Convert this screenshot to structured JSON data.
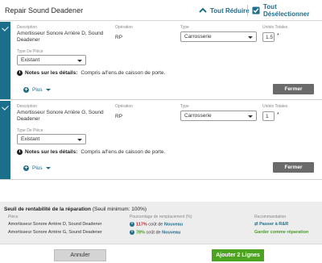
{
  "header": {
    "title": "Repair Sound Deadener",
    "collapse_all": "Tout Réduire",
    "deselect_all": "Tout Désélectionner"
  },
  "labels": {
    "description": "Description",
    "operation": "Opération",
    "type": "Type",
    "units_total": "Unités Totales",
    "part_type": "Type De Pièce",
    "notes": "Notes sur les détails:",
    "more": "Plus",
    "close": "Fermer"
  },
  "items": [
    {
      "description": "Amortisseur Sonore Arrière D, Sound Deadener",
      "operation": "RP",
      "type": "Carrosserie",
      "units": "1.5",
      "part_type": "Existant",
      "note": "Compris a/l'ens.de caisson de porte."
    },
    {
      "description": "Amortisseur Sonore Arrière G, Sound Deadener",
      "operation": "RP",
      "type": "Carrosserie",
      "units": "1",
      "part_type": "Existant",
      "note": "Compris a/l'ens.de caisson de porte."
    }
  ],
  "profitability": {
    "title": "Seuil de rentabilité de la réparation",
    "threshold": "(Seuil minimum: 100%)",
    "col_part": "Pièce",
    "col_pct": "Pourcentage de remplacement (%)",
    "col_rec": "Recommandation",
    "rows": [
      {
        "part": "Amortisseur Sonore Arrière D, Sound Deadener",
        "pct": "117%",
        "pct_text": "coût de",
        "pct_link": "Nouveau",
        "recommendation": "Passer à R&R"
      },
      {
        "part": "Amortisseur Sonore Arrière G, Sound Deadener",
        "pct": "78%",
        "pct_text": "coût de",
        "pct_link": "Nouveau",
        "recommendation": "Garder comme réparation"
      }
    ]
  },
  "footer": {
    "cancel": "Annuler",
    "add": "Ajouter 2 Lignes"
  },
  "colors": {
    "accent": "#1b6f8b",
    "green": "#4ca320",
    "red": "#c2262c"
  }
}
